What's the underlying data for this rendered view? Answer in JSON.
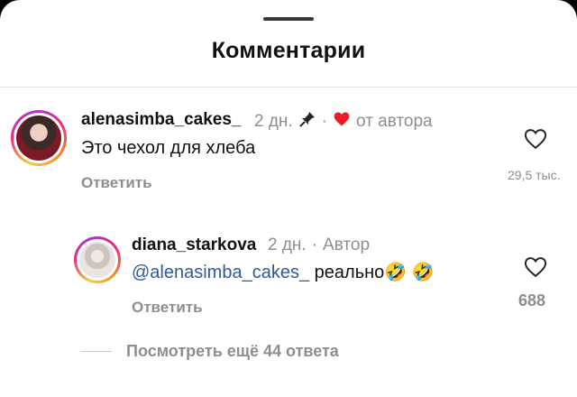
{
  "header": {
    "title": "Комментарии"
  },
  "comments": [
    {
      "username": "alenasimba_cakes_",
      "time": "2 дн.",
      "sep1": "·",
      "liked_by_author": "от автора",
      "text": "Это чехол для хлеба",
      "reply_label": "Ответить",
      "likes": "29,5 тыс."
    }
  ],
  "replies": [
    {
      "username": "diana_starkova",
      "time": "2 дн.",
      "sep": "·",
      "badge": "Автор",
      "mention": "@alenasimba_cakes_",
      "text": " реально",
      "emoji": "🤣 🤣",
      "reply_label": "Ответить",
      "likes": "688"
    }
  ],
  "view_more": "Посмотреть ещё 44 ответа",
  "colors": {
    "accent_heart": "#ed1c24",
    "muted": "#8e8e8e",
    "mention": "#2f5a9e"
  },
  "icons": [
    "pin-icon",
    "heart-filled-icon",
    "heart-outline-icon"
  ]
}
